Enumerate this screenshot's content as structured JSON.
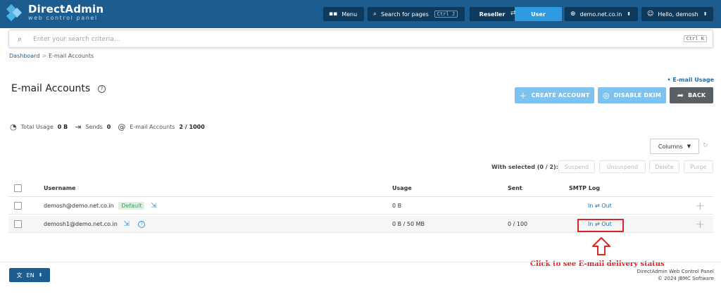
{
  "header": {
    "logo_title": "DirectAdmin",
    "logo_subtitle": "web control panel",
    "menu_label": "Menu",
    "search_pages_label": "Search for pages",
    "search_pages_shortcut": "Ctrl J",
    "reseller_label": "Reseller",
    "user_label": "User",
    "domain_label": "demo.net.co.in",
    "greeting_label": "Hello, demosh"
  },
  "search": {
    "placeholder": "Enter your search criteria...",
    "shortcut": "Ctrl K"
  },
  "breadcrumb": {
    "home": "Dashboard",
    "separator": ">",
    "current": "E-mail Accounts"
  },
  "page": {
    "title": "E-mail Accounts",
    "usage_link": "• E-mail Usage",
    "create_account": "CREATE ACCOUNT",
    "disable_dkim": "DISABLE DKIM",
    "back": "BACK"
  },
  "stats": {
    "total_usage_label": "Total Usage",
    "total_usage_value": "0 B",
    "sends_label": "Sends",
    "sends_value": "0",
    "email_accounts_label": "E-mail Accounts",
    "email_accounts_value": "2 / 1000"
  },
  "toolbar": {
    "columns_label": "Columns",
    "with_selected": "With selected (0 / 2):",
    "suspend": "Suspend",
    "unsuspend": "Unsuspend",
    "delete": "Delete",
    "purge": "Purge"
  },
  "table": {
    "columns": [
      "Username",
      "Usage",
      "Sent",
      "SMTP Log"
    ],
    "rows": [
      {
        "username": "demosh@demo.net.co.in",
        "badge": "Default",
        "usage": "0 B",
        "sent": "",
        "smtp_log": "In ⇄ Out"
      },
      {
        "username": "demosh1@demo.net.co.in",
        "badge": "",
        "usage": "0 B / 50 MB",
        "sent": "0 / 100",
        "smtp_log": "In ⇄ Out"
      }
    ]
  },
  "annotation": {
    "text": "Click to see E-mail delivery status",
    "color": "#e02424"
  },
  "footer": {
    "lang_label": "EN",
    "line1": "DirectAdmin Web Control Panel",
    "line2": "© 2024 JBMC Software"
  },
  "colors": {
    "header_bg": "#1d5c8e",
    "accent": "#2e9be0",
    "button_light": "#7ec3ef",
    "back_button": "#5a5f63"
  },
  "icons": {
    "menu": "grid-icon",
    "search": "search-icon",
    "switch": "swap-icon",
    "domain": "globe-icon",
    "user": "user-circle-icon",
    "create": "plus-icon",
    "dkim": "shield-icon",
    "back": "share-arrow-icon",
    "usage": "pie-icon",
    "sends": "send-icon",
    "accounts": "at-icon",
    "login": "login-icon",
    "help": "question-icon",
    "expand": "plus-icon",
    "refresh": "refresh-icon",
    "language": "translate-icon"
  }
}
